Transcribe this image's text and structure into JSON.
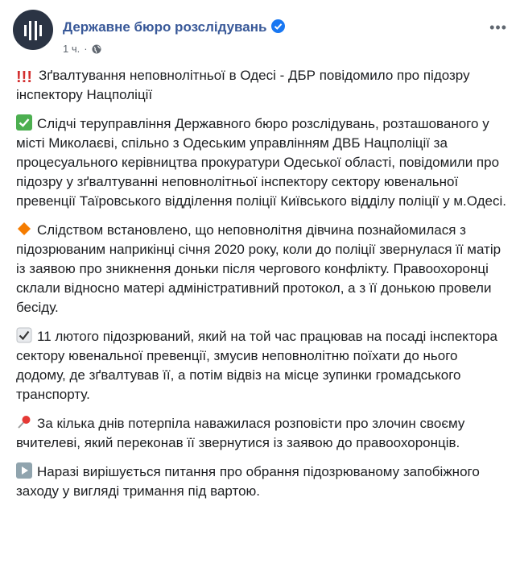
{
  "header": {
    "page_name": "Державне бюро розслідувань",
    "time": "1 ч.",
    "dot": "·",
    "more": "•••"
  },
  "colors": {
    "link": "#385898",
    "verified": "#1877f2",
    "check": "#4caf50",
    "diamond": "#f57c00",
    "pin": "#e53935"
  },
  "posts": {
    "p1": "Зґвалтування неповнолітньої в Одесі - ДБР повідомило про підозру інспектору Нацполіції",
    "p2": "Слідчі теруправління Державного бюро розслідувань, розташованого у місті Миколаєві, спільно з Одеським управлінням ДВБ Нацполіції за процесуального керівництва прокуратури Одеської області, повідомили про підозру у зґвалтуванні неповнолітньої інспектору сектору ювенальної превенції Таїровського відділення поліції Київського відділу поліції у м.Одесі.",
    "p3": "Слідством встановлено, що неповнолітня дівчина познайомилася з підозрюваним наприкінці січня 2020 року, коли до поліції звернулася її матір із заявою про зникнення доньки після чергового конфлікту. Правоохоронці склали відносно матері адміністративний протокол, а з її донькою провели бесіду.",
    "p4": "11 лютого підозрюваний, який на той час працював на посаді інспектора сектору ювенальної превенції, змусив неповнолітню поїхати до нього додому, де зґвалтував її, а потім відвіз на місце зупинки громадського транспорту.",
    "p5": "За кілька днів потерпіла наважилася розповісти про злочин своєму вчителеві, який переконав її звернутися із заявою до правоохоронців.",
    "p6": "Наразі вирішується питання про обрання підозрюваному запобіжного заходу у вигляді тримання під вартою."
  },
  "icons": [
    "avatar-logo",
    "verified-badge-icon",
    "globe-icon",
    "exclamation-icon",
    "check-mark-icon",
    "orange-diamond-icon",
    "checkbox-check-icon",
    "pushpin-icon",
    "play-button-icon"
  ]
}
